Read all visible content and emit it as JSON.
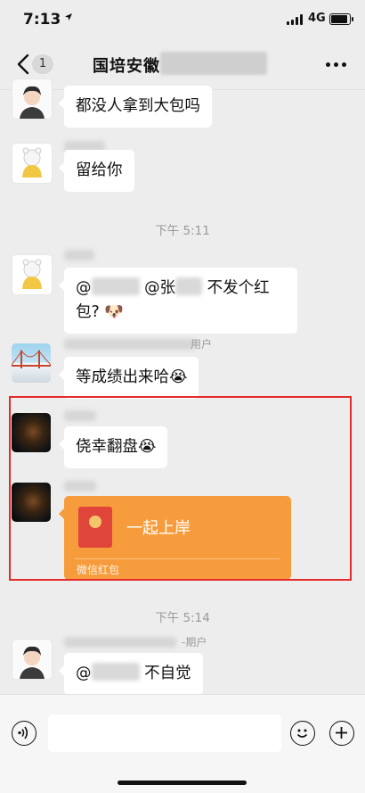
{
  "status_bar": {
    "time": "7:13",
    "network": "4G"
  },
  "header": {
    "back_label": "",
    "unread_count": "1",
    "title": "国培安徽"
  },
  "messages": [
    {
      "text": "都没人拿到大包吗"
    },
    {
      "text": "留给你"
    },
    {
      "timestamp": "下午 5:11"
    },
    {
      "text_before": "@",
      "text_mid": " @张",
      "text_after": " 不发个红",
      "text_line2": "包? 🐶"
    },
    {
      "name_tail": "用户",
      "text": "等成绩出来哈😭"
    },
    {
      "text": "侥幸翻盘😭"
    },
    {
      "red_packet": {
        "title": "一起上岸",
        "label": "微信红包"
      }
    },
    {
      "timestamp": "下午 5:14"
    },
    {
      "name_tail": "-期户",
      "text_before": "@",
      "text_after": " 不自觉"
    }
  ],
  "input_bar": {
    "placeholder": ""
  }
}
